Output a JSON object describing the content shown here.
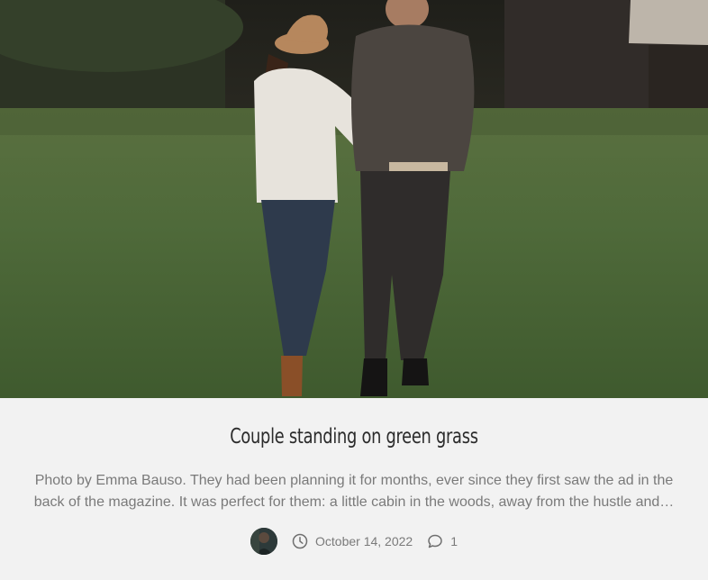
{
  "post": {
    "title": "Couple standing on green grass",
    "excerpt_line1": "Photo by Emma Bauso. They had been planning it for months, ever since they first saw the ad in the",
    "excerpt_line2": "back of the magazine. It was perfect for them: a little cabin in the woods, away from the hustle and…",
    "date": "October 14, 2022",
    "comment_count": "1",
    "icons": {
      "date": "clock-icon",
      "comments": "speech-bubble-icon",
      "author": "avatar"
    }
  }
}
